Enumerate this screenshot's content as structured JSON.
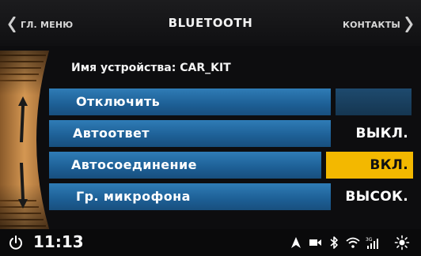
{
  "header": {
    "back_label": "ГЛ. МЕНЮ",
    "title": "BLUETOOTH",
    "contacts_label": "КОНТАКТЫ"
  },
  "device": {
    "name_label": "Имя устройства: CAR_KIT"
  },
  "menu": {
    "items": [
      {
        "label": "Отключить",
        "value": ""
      },
      {
        "label": "Автоответ",
        "value": "ВЫКЛ."
      },
      {
        "label": "Автосоединение",
        "value": "ВКЛ.",
        "selected": true
      },
      {
        "label": "Гр. микрофона",
        "value": "ВЫСОК."
      }
    ]
  },
  "status_bar": {
    "time": "11:13",
    "icons": [
      "power-icon",
      "navigation-icon",
      "media-icon",
      "bluetooth-icon",
      "wifi-icon",
      "signal-3g-icon",
      "brightness-icon"
    ]
  },
  "colors": {
    "row_blue": "#2f7cb6",
    "accent_yellow": "#f3b800",
    "wheel_orange": "#c98a45"
  }
}
